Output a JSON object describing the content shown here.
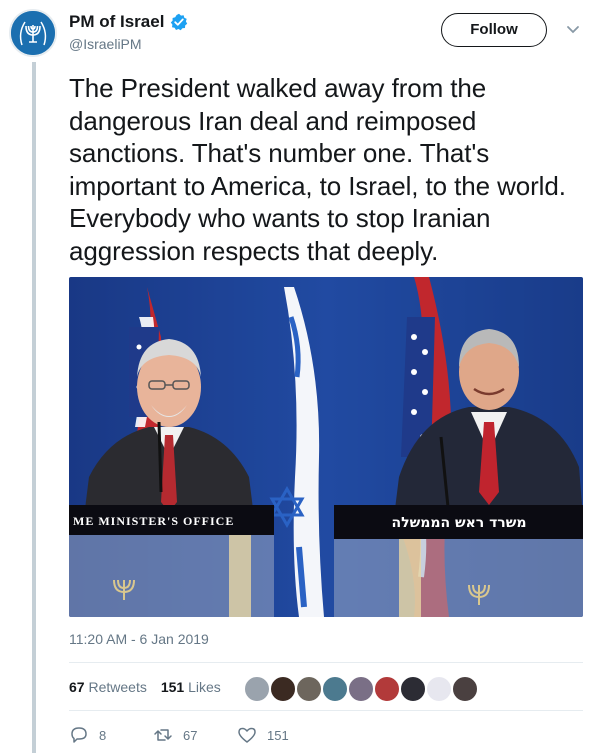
{
  "author": {
    "display_name": "PM of Israel",
    "handle": "@IsraeliPM",
    "avatar_icon": "state-emblem-icon",
    "verified_icon": "verified-badge-icon"
  },
  "follow_label": "Follow",
  "tweet": {
    "text": "The President walked away from the dangerous Iran deal and reimposed sanctions. That's number one. That's important to America, to Israel, to the world. Everybody who wants to stop Iranian aggression respects that deeply.",
    "timestamp": "11:20 AM - 6 Jan 2019"
  },
  "photo": {
    "podium_left_text": "ME MINISTER'S OFFICE",
    "podium_right_text": "משרד ראש הממשלה"
  },
  "stats": {
    "retweets_count": "67",
    "retweets_label": "Retweets",
    "likes_count": "151",
    "likes_label": "Likes"
  },
  "actions": {
    "replies": "8",
    "retweets": "67",
    "likes": "151"
  },
  "colors": {
    "accent": "#1da1f2",
    "secondary_text": "#657786",
    "photo_background": "#1f3f8f"
  }
}
